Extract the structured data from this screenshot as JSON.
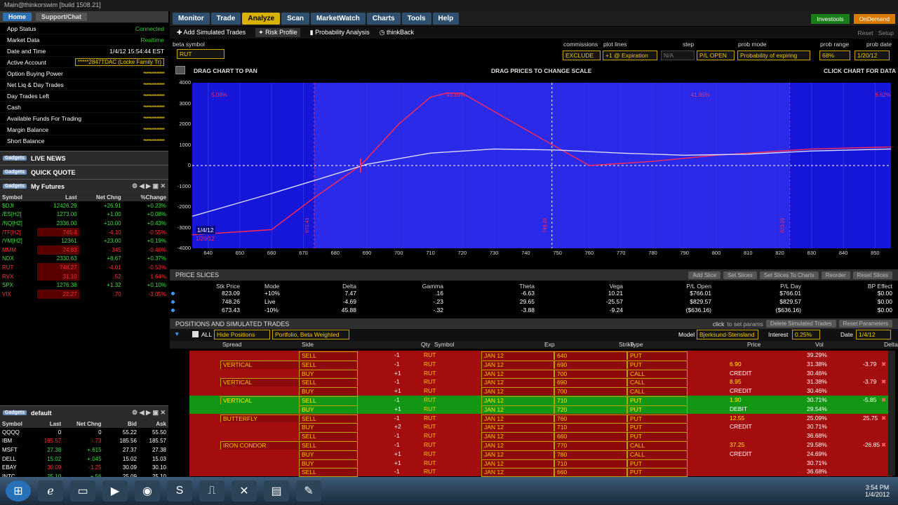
{
  "window": {
    "title": "Main@thinkorswim [build 1508.21]"
  },
  "left": {
    "home": "Home",
    "support": "Support/Chat",
    "account_rows": [
      {
        "label": "App Status",
        "value": "Connected",
        "kind": "g"
      },
      {
        "label": "Market Data",
        "value": "Realtime",
        "kind": "g"
      },
      {
        "label": "Date and Time",
        "value": "1/4/12 15:54:44 EST",
        "kind": "v"
      },
      {
        "label": "Active Account",
        "value": "*****2847TDAC (Locke Family Tr)",
        "kind": "sel"
      },
      {
        "label": "Option Buying Power",
        "value": "*************",
        "kind": "m"
      },
      {
        "label": "Net Liq & Day Trades",
        "value": "*************",
        "kind": "m"
      },
      {
        "label": "Day Trades Left",
        "value": "*************",
        "kind": "m"
      },
      {
        "label": "Cash",
        "value": "*************",
        "kind": "m"
      },
      {
        "label": "Available Funds For Trading",
        "value": "*************",
        "kind": "m"
      },
      {
        "label": "Margin Balance",
        "value": "*************",
        "kind": "m"
      },
      {
        "label": "Short Balance",
        "value": "*************",
        "kind": "m"
      }
    ],
    "gadget_tag": "Gadgets",
    "live_news": "LIVE NEWS",
    "quick_quote": "QUICK QUOTE",
    "futures_title": "My Futures",
    "futures_cols": [
      "Symbol",
      "Last",
      "Net Chng",
      "%Change"
    ],
    "futures": [
      {
        "s": "$DJI",
        "l": "12426.29",
        "n": "+26.91",
        "p": "+0.23%",
        "d": "pos"
      },
      {
        "s": "/ES[H2]",
        "l": "1273.00",
        "n": "+1.00",
        "p": "+0.08%",
        "d": "pos"
      },
      {
        "s": "/NQ[H2]",
        "l": "2336.00",
        "n": "+10.00",
        "p": "+0.43%",
        "d": "pos"
      },
      {
        "s": "/TF[H2]",
        "l": "745.4",
        "n": "-4.10",
        "p": "-0.55%",
        "d": "neg"
      },
      {
        "s": "/YM[H2]",
        "l": "12361",
        "n": "+23.00",
        "p": "+0.19%",
        "d": "pos"
      },
      {
        "s": "MMM",
        "l": "74.83",
        "n": "-.345",
        "p": "-0.46%",
        "d": "neg"
      },
      {
        "s": "NDX",
        "l": "2330.63",
        "n": "+8.67",
        "p": "+0.37%",
        "d": "pos"
      },
      {
        "s": "RUT",
        "l": "748.27",
        "n": "-4.01",
        "p": "-0.53%",
        "d": "neg"
      },
      {
        "s": "RVX",
        "l": "31.10",
        "n": ".52",
        "p": "1.64%",
        "d": "neg"
      },
      {
        "s": "SPX",
        "l": "1276.38",
        "n": "+1.32",
        "p": "+0.10%",
        "d": "pos"
      },
      {
        "s": "VIX",
        "l": "22.27",
        "n": ".70",
        "p": "-3.05%",
        "d": "neg"
      }
    ],
    "default_title": "default",
    "quote_cols": [
      "Symbol",
      "Last",
      "Net Chng",
      "",
      "Bid",
      "Ask"
    ],
    "quotes": [
      {
        "s": "QQQQ",
        "l": "0",
        "n": "0",
        "b": "55.22",
        "a": "55.50",
        "d": "wht"
      },
      {
        "s": "IBM",
        "l": "185.57",
        "n": "-.73",
        "b": "185.56",
        "a": "185.57",
        "d": "neg"
      },
      {
        "s": "MSFT",
        "l": "27.38",
        "n": "+.615",
        "b": "27.37",
        "a": "27.38",
        "d": "pos"
      },
      {
        "s": "DELL",
        "l": "15.02",
        "n": "+.045",
        "b": "15.02",
        "a": "15.03",
        "d": "pos"
      },
      {
        "s": "EBAY",
        "l": "30.09",
        "n": "-1.25",
        "b": "30.09",
        "a": "30.10",
        "d": "neg"
      },
      {
        "s": "INTC",
        "l": "25.10",
        "n": "+.56",
        "b": "25.09",
        "a": "25.10",
        "d": "pos"
      }
    ]
  },
  "tabs": [
    "Monitor",
    "Trade",
    "Analyze",
    "Scan",
    "MarketWatch",
    "Charts",
    "Tools",
    "Help"
  ],
  "top_right": {
    "investools": "Investools",
    "ondemand": "OnDemand",
    "reset": "Reset",
    "setup": "Setup"
  },
  "subtabs": [
    "Add Simulated Trades",
    "Risk Profile",
    "Probability Analysis",
    "thinkBack"
  ],
  "controls": {
    "beta_label": "beta symbol",
    "beta_value": "RUT",
    "commissions_label": "commissions",
    "commissions_value": "EXCLUDE",
    "plot_label": "plot lines",
    "plot_value": "+1 @ Expiration",
    "step_label": "step",
    "step_value": "N/A",
    "pl_value": "P/L OPEN",
    "prob_mode_label": "prob mode",
    "prob_mode_value": "Probability of expiring",
    "prob_range_label": "prob range",
    "prob_range_value": "68%",
    "prob_date_label": "prob date",
    "prob_date_value": "1/20/12"
  },
  "chart_hints": {
    "pan": "DRAG CHART TO PAN",
    "scale": "DRAG PRICES TO CHANGE SCALE",
    "data": "CLICK CHART FOR DATA"
  },
  "chart_data": {
    "type": "line",
    "xlim": [
      635,
      855
    ],
    "ylim": [
      -4000,
      4000
    ],
    "x_ticks": [
      640,
      650,
      660,
      670,
      680,
      690,
      700,
      710,
      720,
      730,
      740,
      750,
      760,
      770,
      780,
      790,
      800,
      810,
      820,
      830,
      840,
      850
    ],
    "y_ticks": [
      "4000",
      "3000",
      "2000",
      "1000",
      "0",
      "-1000",
      "-2000",
      "-3000",
      "-4000"
    ],
    "series": [
      {
        "name": "1/20/12",
        "color": "#ff2a55",
        "points": [
          [
            635,
            -3350
          ],
          [
            660,
            -3100
          ],
          [
            673,
            -1600
          ],
          [
            688,
            0
          ],
          [
            700,
            2000
          ],
          [
            710,
            3300
          ],
          [
            715,
            3500
          ],
          [
            720,
            3500
          ],
          [
            745,
            1300
          ],
          [
            760,
            0
          ],
          [
            780,
            200
          ],
          [
            800,
            500
          ],
          [
            830,
            800
          ],
          [
            855,
            900
          ]
        ]
      },
      {
        "name": "1/4/12",
        "color": "#dcdcff",
        "points": [
          [
            635,
            -2450
          ],
          [
            660,
            -1350
          ],
          [
            675,
            -650
          ],
          [
            690,
            60
          ],
          [
            710,
            600
          ],
          [
            730,
            800
          ],
          [
            750,
            750
          ],
          [
            770,
            600
          ],
          [
            790,
            500
          ],
          [
            810,
            550
          ],
          [
            830,
            700
          ],
          [
            855,
            800
          ]
        ]
      }
    ],
    "vlines": [
      {
        "x": 673.43,
        "label": "673.43"
      },
      {
        "x": 748.26,
        "label": "748.26"
      },
      {
        "x": 823.09,
        "label": "823.09"
      }
    ],
    "pct_labels": [
      {
        "x": 641,
        "text": "5.08%"
      },
      {
        "x": 715,
        "text": "45.89%"
      },
      {
        "x": 792,
        "text": "41.85%"
      },
      {
        "x": 850,
        "text": "6.62%"
      }
    ],
    "legend": [
      "1/4/12",
      "1/20/12"
    ]
  },
  "price_slices": {
    "title": "PRICE SLICES",
    "buttons": [
      "Add Slice",
      "Set Slices",
      "Set Slices To Charts",
      "Reorder",
      "Reset Slices"
    ],
    "cols": [
      "Stk Price",
      "Mode",
      "Delta",
      "Gamma",
      "Theta",
      "Vega",
      "P/L Open",
      "P/L Day",
      "BP Effect"
    ],
    "rows": [
      [
        "823.09",
        "+10%",
        "7.47",
        ".16",
        "-6.63",
        "10.21",
        "$766.01",
        "$766.01",
        "$0.00"
      ],
      [
        "748.26",
        "Live",
        "-4.69",
        "-.23",
        "29.65",
        "-25.57",
        "$829.57",
        "$829.57",
        "$0.00"
      ],
      [
        "673.43",
        "-10%",
        "45.88",
        "-.32",
        "-3.88",
        "-9.24",
        "($636.16)",
        "($636.16)",
        "$0.00"
      ]
    ]
  },
  "positions": {
    "title": "POSITIONS AND SIMULATED TRADES",
    "click_hint": "click",
    "set_params": "to set params",
    "delete_btn": "Delete Simulated Trades",
    "reset_btn": "Reset Parameters",
    "all": "ALL",
    "hide": "Hide Positions",
    "weight": "Portfolio, Beta Weighted",
    "model_label": "Model",
    "model_value": "Bjerksund-Stensland",
    "interest_label": "Interest",
    "interest_value": "0.25%",
    "date_label": "Date",
    "date_value": "1/4/12",
    "cols": [
      "Spread",
      "Side",
      "Qty",
      "Symbol",
      "Exp",
      "Strike",
      "Type",
      "Price",
      "Vol",
      "Delta"
    ],
    "rows": [
      {
        "spread": "",
        "side": "SELL",
        "qty": "-1",
        "sym": "RUT",
        "exp": "JAN 12",
        "strike": "640",
        "type": "PUT",
        "price": "",
        "vol": "39.29%",
        "delta": "",
        "g": false
      },
      {
        "spread": "VERTICAL",
        "side": "SELL",
        "qty": "-1",
        "sym": "RUT",
        "exp": "JAN 12",
        "strike": "690",
        "type": "PUT",
        "price": "6.90",
        "vol": "31.38%",
        "delta": "-3.79",
        "g": false
      },
      {
        "spread": "",
        "side": "BUY",
        "qty": "+1",
        "sym": "RUT",
        "exp": "JAN 12",
        "strike": "700",
        "type": "CALL",
        "price": "CREDIT",
        "vol": "30.46%",
        "delta": "",
        "g": false
      },
      {
        "spread": "VERTICAL",
        "side": "SELL",
        "qty": "-1",
        "sym": "RUT",
        "exp": "JAN 12",
        "strike": "690",
        "type": "CALL",
        "price": "8.95",
        "vol": "31.38%",
        "delta": "-3.79",
        "g": false
      },
      {
        "spread": "",
        "side": "BUY",
        "qty": "+1",
        "sym": "RUT",
        "exp": "JAN 12",
        "strike": "700",
        "type": "CALL",
        "price": "CREDIT",
        "vol": "30.46%",
        "delta": "",
        "g": false
      },
      {
        "spread": "VERTICAL",
        "side": "SELL",
        "qty": "-1",
        "sym": "RUT",
        "exp": "JAN 12",
        "strike": "710",
        "type": "PUT",
        "price": "1.90",
        "vol": "30.71%",
        "delta": "-5.85",
        "g": true
      },
      {
        "spread": "",
        "side": "BUY",
        "qty": "+1",
        "sym": "RUT",
        "exp": "JAN 12",
        "strike": "720",
        "type": "PUT",
        "price": "DEBIT",
        "vol": "29.54%",
        "delta": "",
        "g": true
      },
      {
        "spread": "BUTTERFLY",
        "side": "SELL",
        "qty": "-1",
        "sym": "RUT",
        "exp": "JAN 12",
        "strike": "760",
        "type": "PUT",
        "price": "12.55",
        "vol": "25.09%",
        "delta": "25.75",
        "g": false
      },
      {
        "spread": "",
        "side": "BUY",
        "qty": "+2",
        "sym": "RUT",
        "exp": "JAN 12",
        "strike": "710",
        "type": "PUT",
        "price": "CREDIT",
        "vol": "30.71%",
        "delta": "",
        "g": false
      },
      {
        "spread": "",
        "side": "SELL",
        "qty": "-1",
        "sym": "RUT",
        "exp": "JAN 12",
        "strike": "660",
        "type": "PUT",
        "price": "",
        "vol": "36.68%",
        "delta": "",
        "g": false
      },
      {
        "spread": "IRON CONDOR",
        "side": "SELL",
        "qty": "-1",
        "sym": "RUT",
        "exp": "JAN 12",
        "strike": "770",
        "type": "CALL",
        "price": "37.25",
        "vol": "29.58%",
        "delta": "-26.85",
        "g": false
      },
      {
        "spread": "",
        "side": "BUY",
        "qty": "+1",
        "sym": "RUT",
        "exp": "JAN 12",
        "strike": "780",
        "type": "CALL",
        "price": "CREDIT",
        "vol": "24.69%",
        "delta": "",
        "g": false
      },
      {
        "spread": "",
        "side": "BUY",
        "qty": "+1",
        "sym": "RUT",
        "exp": "JAN 12",
        "strike": "710",
        "type": "PUT",
        "price": "",
        "vol": "30.71%",
        "delta": "",
        "g": false
      },
      {
        "spread": "",
        "side": "SELL",
        "qty": "-1",
        "sym": "RUT",
        "exp": "JAN 12",
        "strike": "660",
        "type": "PUT",
        "price": "",
        "vol": "36.68%",
        "delta": "",
        "g": false
      }
    ]
  },
  "taskbar": {
    "time": "3:54 PM",
    "date": "1/4/2012",
    "icons": [
      "start-orb",
      "ie-icon",
      "explorer-icon",
      "media-player-icon",
      "firefox-icon",
      "skype-icon",
      "thinkorswim-icon",
      "excel-icon",
      "folder-icon",
      "app-icon"
    ]
  }
}
